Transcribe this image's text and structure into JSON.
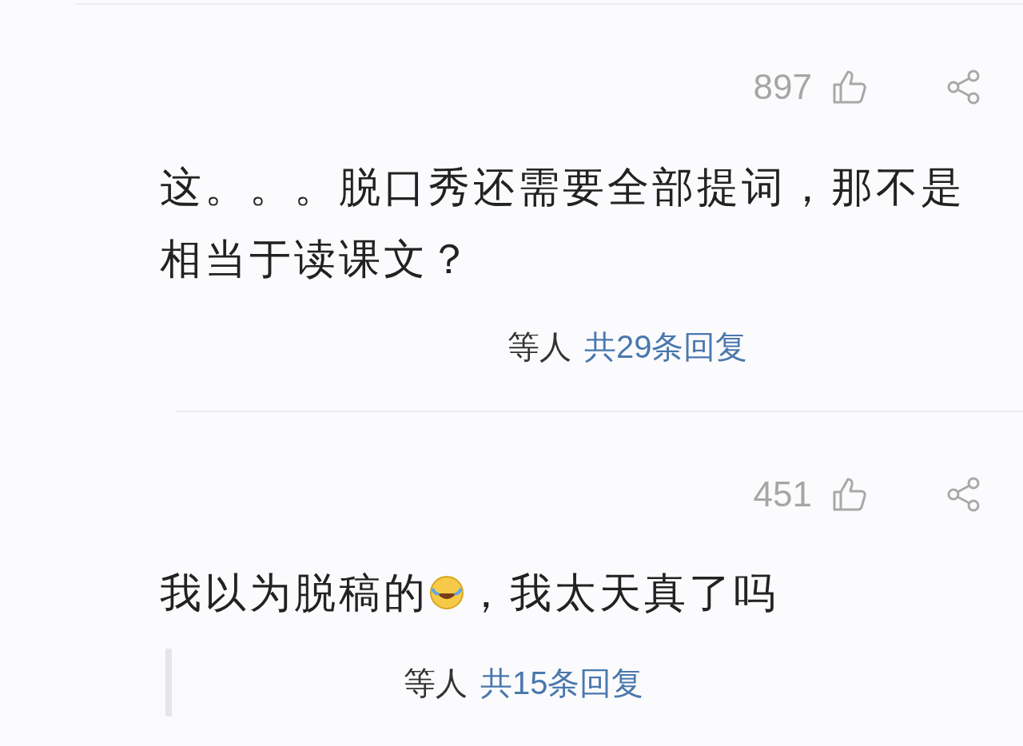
{
  "comments": [
    {
      "likes": "897",
      "text": "这。。。脱口秀还需要全部提词，那不是相当于读课文？",
      "replies": {
        "prefix": "等人",
        "link": "共29条回复"
      }
    },
    {
      "likes": "451",
      "text_before": "我以为脱稿的",
      "text_after": "，我太天真了吗",
      "replies": {
        "prefix": "等人",
        "link": "共15条回复"
      },
      "reply_bar": true
    }
  ]
}
